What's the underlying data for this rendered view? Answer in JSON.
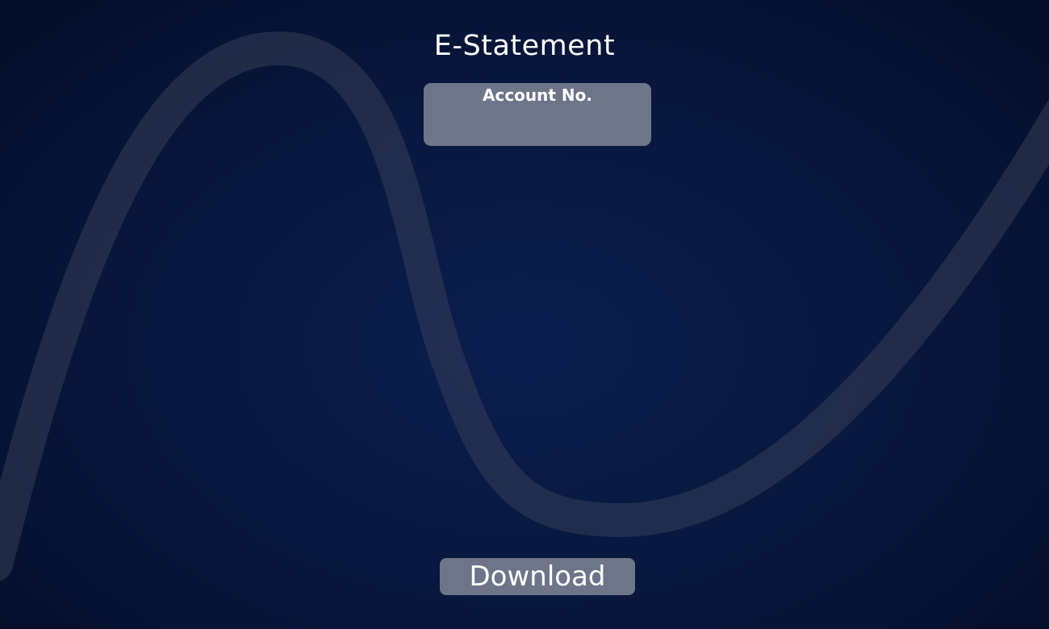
{
  "page": {
    "title": "E-Statement"
  },
  "account": {
    "label": "Account No.",
    "value": ""
  },
  "actions": {
    "download_label": "Download"
  },
  "colors": {
    "background_dark": "#061231",
    "background_center": "#0a1d4f",
    "panel_fill": "#6f7588",
    "text": "#ffffff",
    "wave_stroke": "#3a4258"
  }
}
